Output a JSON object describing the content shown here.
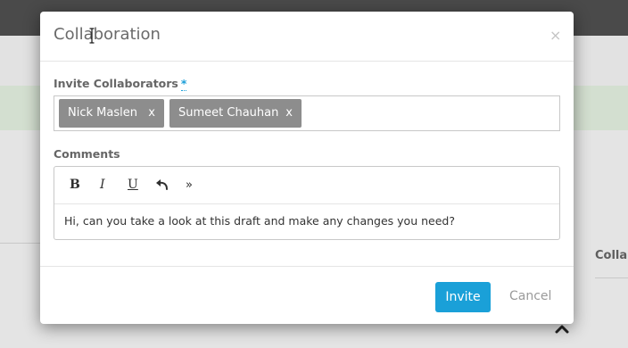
{
  "background": {
    "side_label": "Collab"
  },
  "modal": {
    "title": "Collaboration",
    "close_label": "×",
    "invite": {
      "label": "Invite Collaborators",
      "required_marker": "*",
      "tags": [
        {
          "name": "Nick Maslen",
          "remove": "x"
        },
        {
          "name": "Sumeet Chauhan",
          "remove": "x"
        }
      ]
    },
    "comments": {
      "label": "Comments",
      "toolbar": {
        "bold": "B",
        "italic": "I",
        "underline": "U",
        "undo_icon": "undo-icon",
        "more": "»"
      },
      "body": "Hi, can you take a look at this draft and make any changes you need?"
    },
    "footer": {
      "invite_label": "Invite",
      "cancel_label": "Cancel"
    }
  },
  "colors": {
    "accent": "#1aa0d8",
    "tag_bg": "#8d8d8d"
  }
}
